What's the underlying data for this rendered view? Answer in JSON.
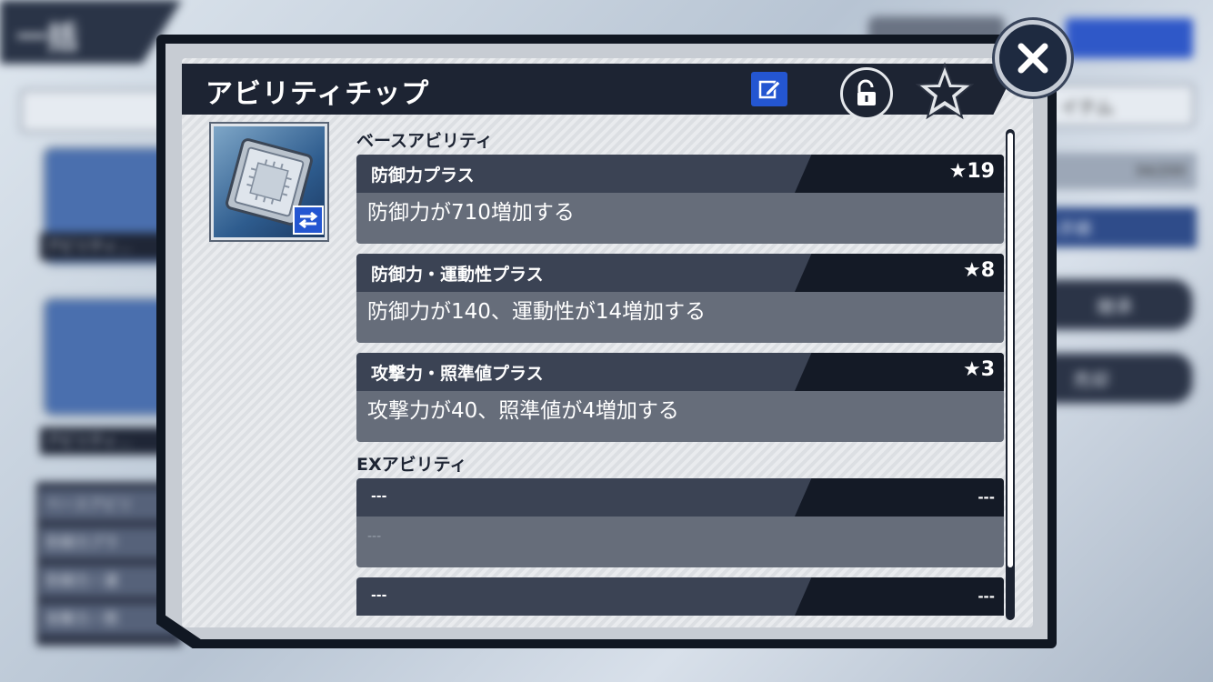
{
  "background": {
    "back_label": "一括",
    "left_cards": [
      {
        "label": "アビリティ…"
      },
      {
        "label": "アビリティ…"
      }
    ],
    "left_list_header": "ベースアビリ",
    "left_list_items": [
      "防御力プラ",
      "防御力・運",
      "攻撃力・照"
    ],
    "right_tab": "イテム",
    "right_count": "34/200",
    "right_sort": "入手順",
    "right_buttons": [
      "継承",
      "売却"
    ]
  },
  "dialog": {
    "title": "アビリティチップ",
    "icons": {
      "edit": "edit-icon",
      "lock": "unlock-icon",
      "favorite": "star-icon",
      "close": "close-icon",
      "swap": "swap-icon"
    },
    "base_section_label": "ベースアビリティ",
    "base_abilities": [
      {
        "name": "防御力プラス",
        "rank": "★19",
        "description": "防御力が710増加する"
      },
      {
        "name": "防御力・運動性プラス",
        "rank": "★8",
        "description": "防御力が140、運動性が14増加する"
      },
      {
        "name": "攻撃力・照準値プラス",
        "rank": "★3",
        "description": "攻撃力が40、照準値が4増加する"
      }
    ],
    "ex_section_label": "EXアビリティ",
    "ex_abilities": [
      {
        "name": "---",
        "rank": "---",
        "description": "---"
      },
      {
        "name": "---",
        "rank": "---"
      }
    ]
  },
  "colors": {
    "accent_blue": "#2456d1",
    "panel_dark": "#1d2433",
    "description_bg": "#666d7a"
  }
}
